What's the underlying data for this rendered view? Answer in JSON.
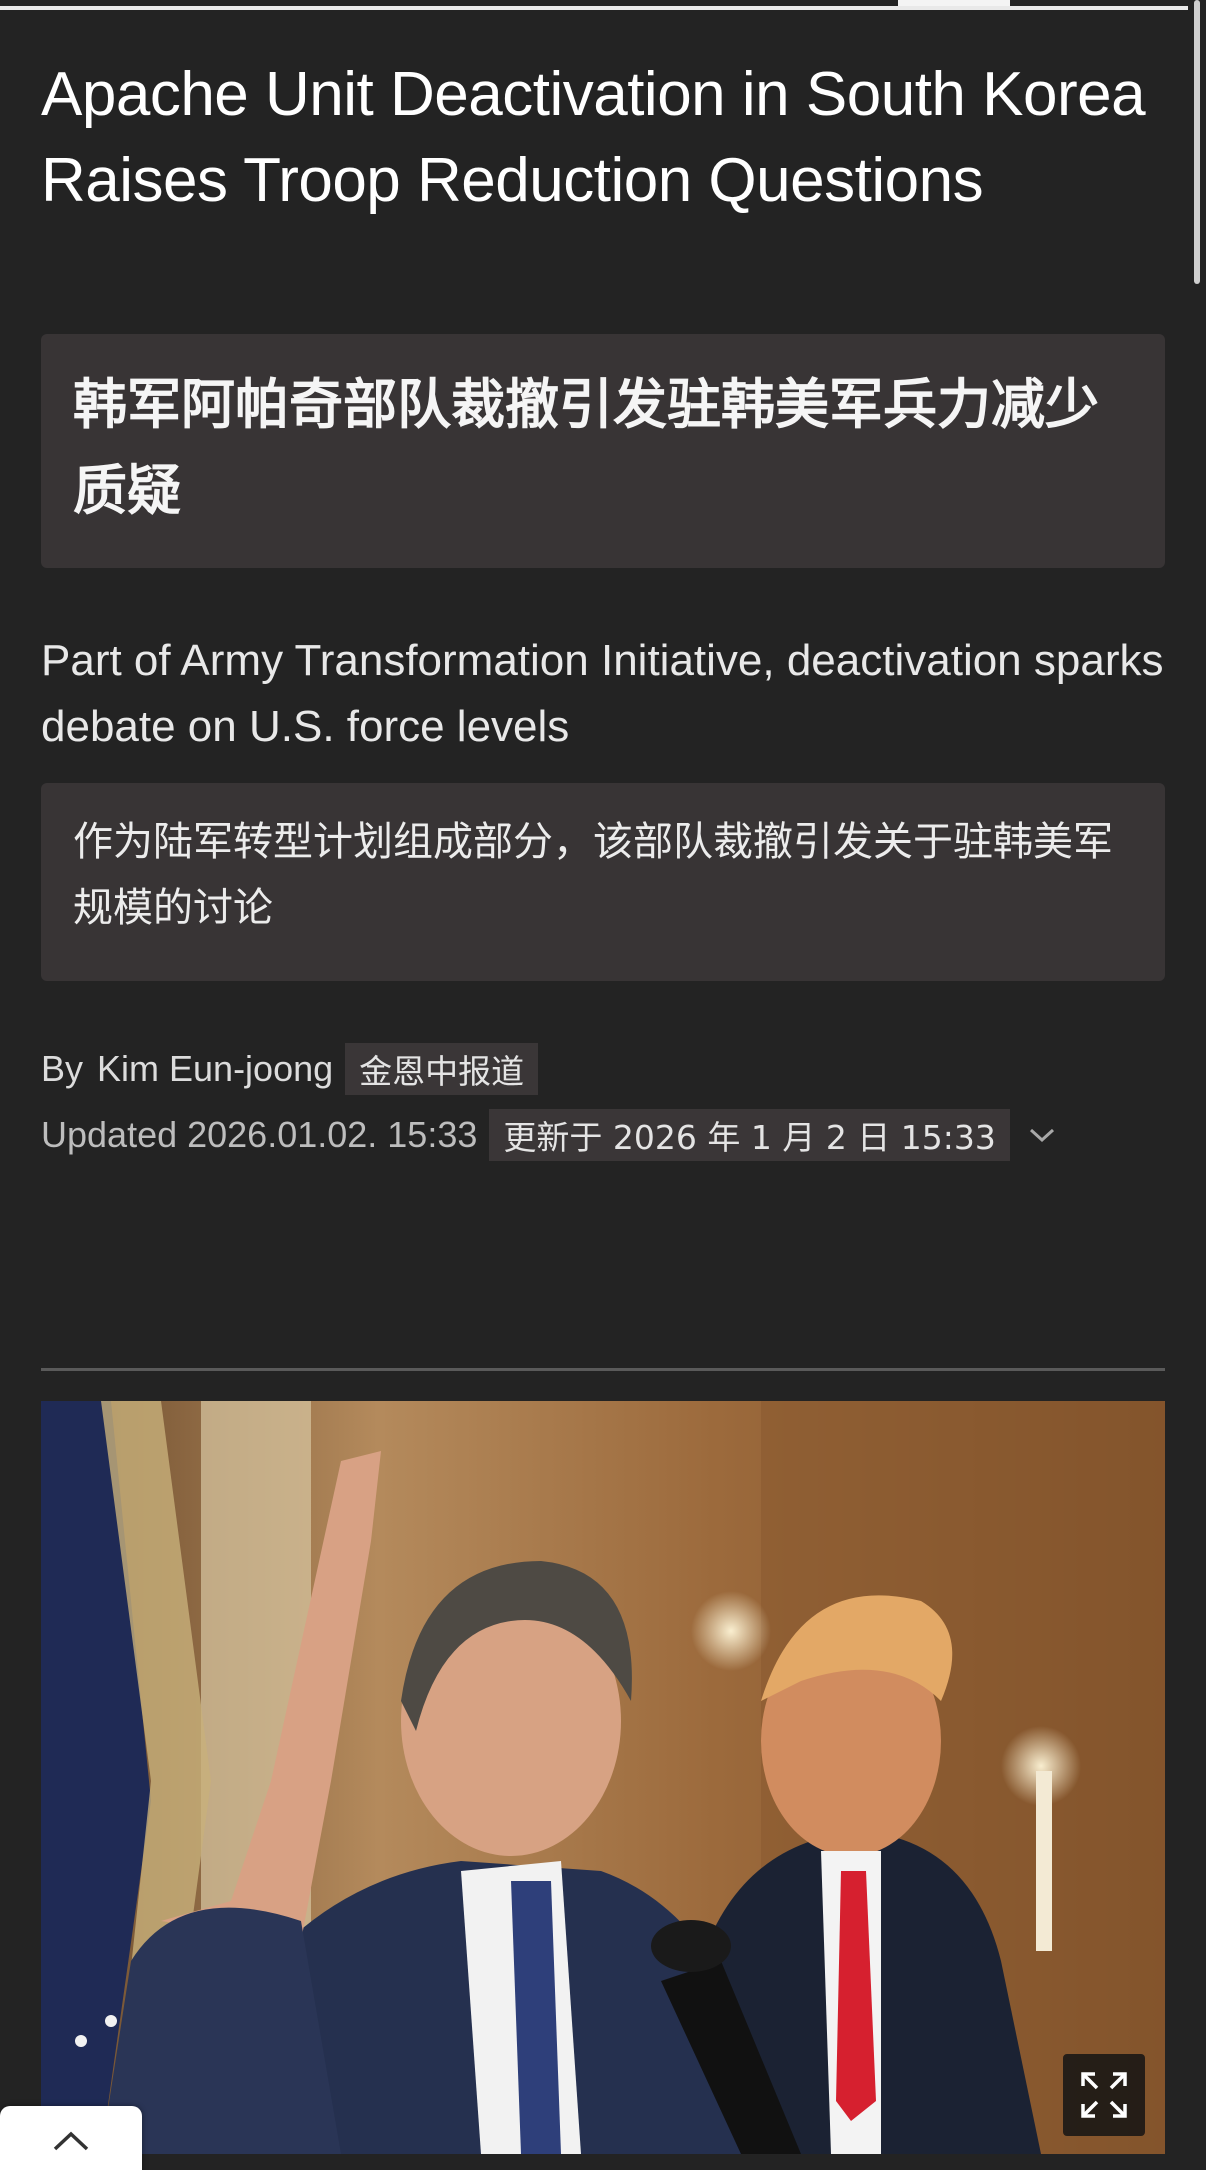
{
  "article": {
    "headline": "Apache Unit Deactivation in South Korea Raises Troop Reduction Questions",
    "headline_translation": "韩军阿帕奇部队裁撤引发驻韩美军兵力减少质疑",
    "subtitle": "Part of Army Transformation Initiative, deactivation sparks debate on U.S. force levels",
    "subtitle_translation": "作为陆军转型计划组成部分，该部队裁撤引发关于驻韩美军规模的讨论",
    "byline": {
      "prefix": "By",
      "author": "Kim Eun-joong",
      "author_translation": "金恩中报道"
    },
    "updated": {
      "text": "Updated 2026.01.02. 15:33",
      "translation": "更新于 2026 年 1 月 2 日 15:33"
    }
  },
  "photo": {
    "expand_icon": "expand-icon"
  },
  "controls": {
    "scroll_top_icon": "chevron-up-icon",
    "details_icon": "chevron-down-icon"
  },
  "colors": {
    "background": "#232323",
    "translation_box": "#383435",
    "text": "#ffffff"
  }
}
